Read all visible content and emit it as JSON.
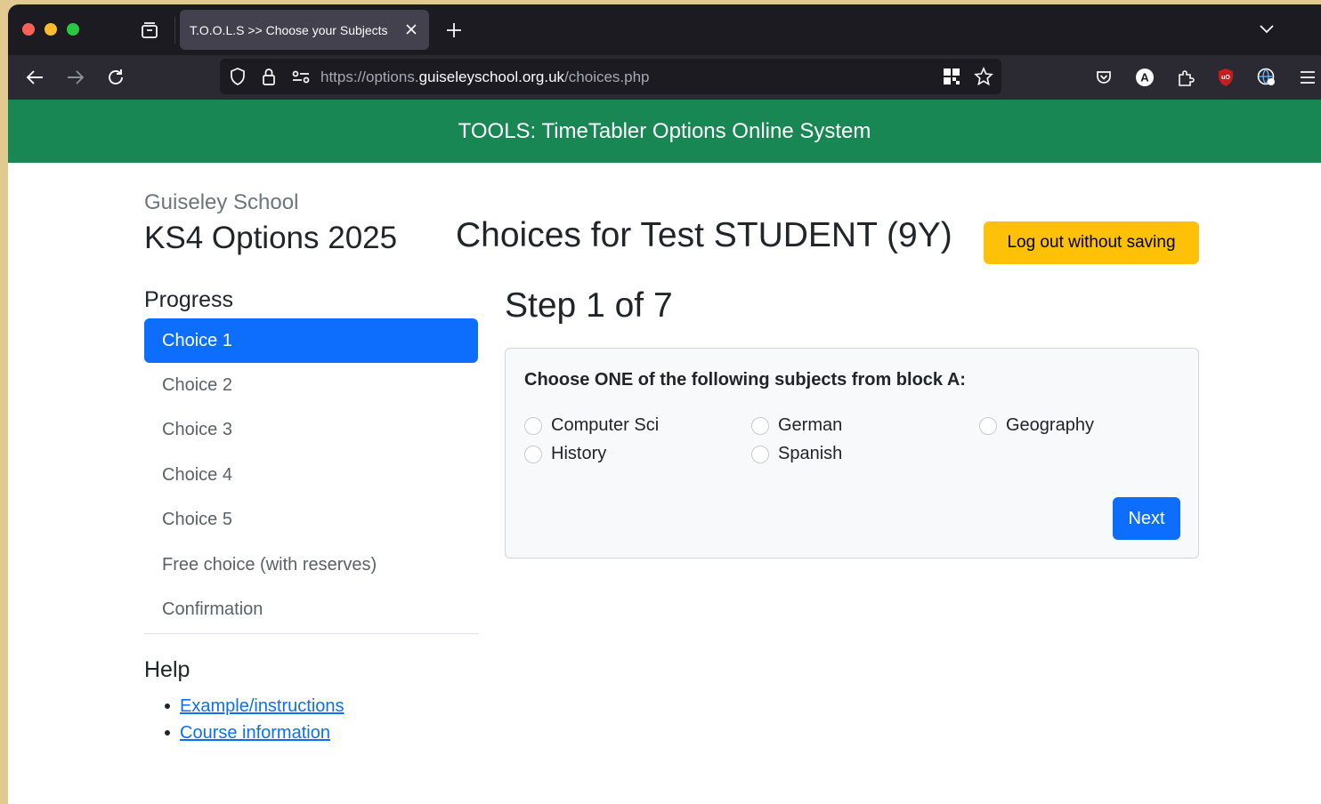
{
  "browser": {
    "tab_title": "T.O.O.L.S >> Choose your Subjects",
    "url_prefix": "https://options.",
    "url_host": "guiseleyschool.org.uk",
    "url_path": "/choices.php"
  },
  "banner": {
    "title": "TOOLS: TimeTabler Options Online System"
  },
  "header": {
    "school_name": "Guiseley School",
    "options_title": "KS4 Options 2025",
    "student_title": "Choices for Test STUDENT (9Y)",
    "logout_label": "Log out without saving"
  },
  "progress": {
    "heading": "Progress",
    "items": [
      "Choice 1",
      "Choice 2",
      "Choice 3",
      "Choice 4",
      "Choice 5",
      "Free choice (with reserves)",
      "Confirmation"
    ],
    "active_index": 0
  },
  "help": {
    "heading": "Help",
    "links": [
      "Example/instructions",
      "Course information"
    ]
  },
  "step": {
    "title": "Step 1 of 7",
    "prompt": "Choose ONE of the following subjects from block A:",
    "options": [
      "Computer Sci",
      "German",
      "Geography",
      "History",
      "Spanish"
    ],
    "next_label": "Next"
  },
  "colors": {
    "banner": "#198754",
    "primary": "#0d6efd",
    "warning": "#ffc107"
  }
}
